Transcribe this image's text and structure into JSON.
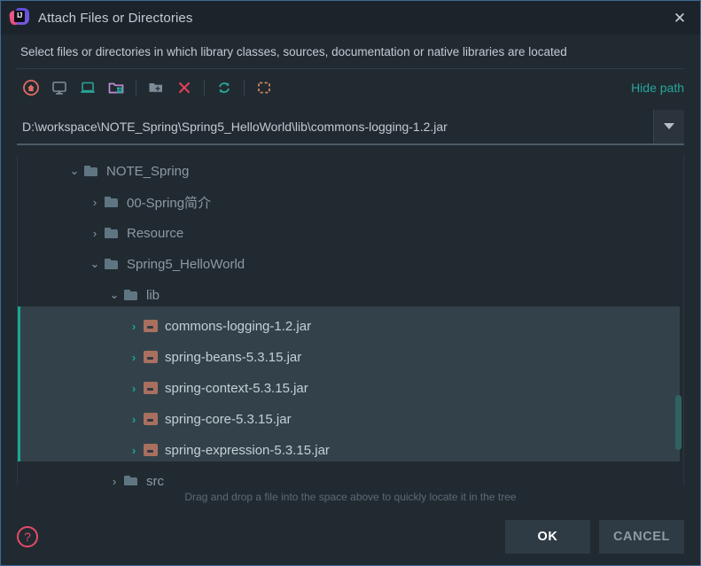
{
  "window": {
    "title": "Attach Files or Directories",
    "app_icon": "intellij-idea-icon",
    "close_icon": "✕"
  },
  "description": "Select files or directories in which library classes, sources, documentation or native libraries are located",
  "toolbar": {
    "hide_path_label": "Hide path",
    "buttons": [
      {
        "name": "home-icon",
        "title": "Home",
        "color": "#e06c63"
      },
      {
        "name": "desktop-icon",
        "title": "Desktop",
        "color": "#7d8d99"
      },
      {
        "name": "laptop-icon",
        "title": "Project Directory",
        "color": "#2aa69a"
      },
      {
        "name": "module-folder-icon",
        "title": "Module Directory",
        "color": "#c18bd8"
      },
      {
        "name": "new-folder-icon",
        "title": "New Folder",
        "color": "#7d8d99"
      },
      {
        "name": "delete-icon",
        "title": "Delete",
        "color": "#e0405a"
      },
      {
        "name": "refresh-icon",
        "title": "Refresh",
        "color": "#2aa69a"
      },
      {
        "name": "select-region-icon",
        "title": "Show Hidden Files",
        "color": "#c9875c"
      }
    ]
  },
  "path_field": {
    "value": "D:\\workspace\\NOTE_Spring\\Spring5_HelloWorld\\lib\\commons-logging-1.2.jar",
    "placeholder": "",
    "dropdown_icon": "chevron-down-icon"
  },
  "tree": {
    "rows": [
      {
        "label": "NOTE_Spring",
        "indent": 55,
        "chevron": "expanded",
        "icon": "folder",
        "selected": false
      },
      {
        "label": "00-Spring简介",
        "indent": 78,
        "chevron": "collapsed",
        "icon": "folder",
        "selected": false
      },
      {
        "label": "Resource",
        "indent": 78,
        "chevron": "collapsed",
        "icon": "folder",
        "selected": false
      },
      {
        "label": "Spring5_HelloWorld",
        "indent": 78,
        "chevron": "expanded",
        "icon": "folder",
        "selected": false
      },
      {
        "label": "lib",
        "indent": 100,
        "chevron": "expanded",
        "icon": "folder",
        "selected": false
      },
      {
        "label": "commons-logging-1.2.jar",
        "indent": 122,
        "chevron": "collapsed-teal",
        "icon": "jar",
        "selected": true
      },
      {
        "label": "spring-beans-5.3.15.jar",
        "indent": 122,
        "chevron": "collapsed-teal",
        "icon": "jar",
        "selected": true
      },
      {
        "label": "spring-context-5.3.15.jar",
        "indent": 122,
        "chevron": "collapsed-teal",
        "icon": "jar",
        "selected": true
      },
      {
        "label": "spring-core-5.3.15.jar",
        "indent": 122,
        "chevron": "collapsed-teal",
        "icon": "jar",
        "selected": true
      },
      {
        "label": "spring-expression-5.3.15.jar",
        "indent": 122,
        "chevron": "collapsed-teal",
        "icon": "jar",
        "selected": true
      },
      {
        "label": "src",
        "indent": 100,
        "chevron": "collapsed",
        "icon": "folder",
        "selected": false
      }
    ],
    "chevron_expanded_glyph": "⌄",
    "chevron_collapsed_glyph": "›",
    "scrollbar": {
      "name": "vertical-scrollbar",
      "thumb_color": "#2f6360"
    }
  },
  "drag_hint": "Drag and drop a file into the space above to quickly locate it in the tree",
  "footer": {
    "help_glyph": "?",
    "ok_label": "OK",
    "cancel_label": "CANCEL"
  },
  "colors": {
    "accent_teal": "#17a892",
    "selection_bg": "#33424a",
    "dialog_bg": "#212a31",
    "titlebar_bg": "#1c242b",
    "border_blue": "#3d6a94"
  }
}
